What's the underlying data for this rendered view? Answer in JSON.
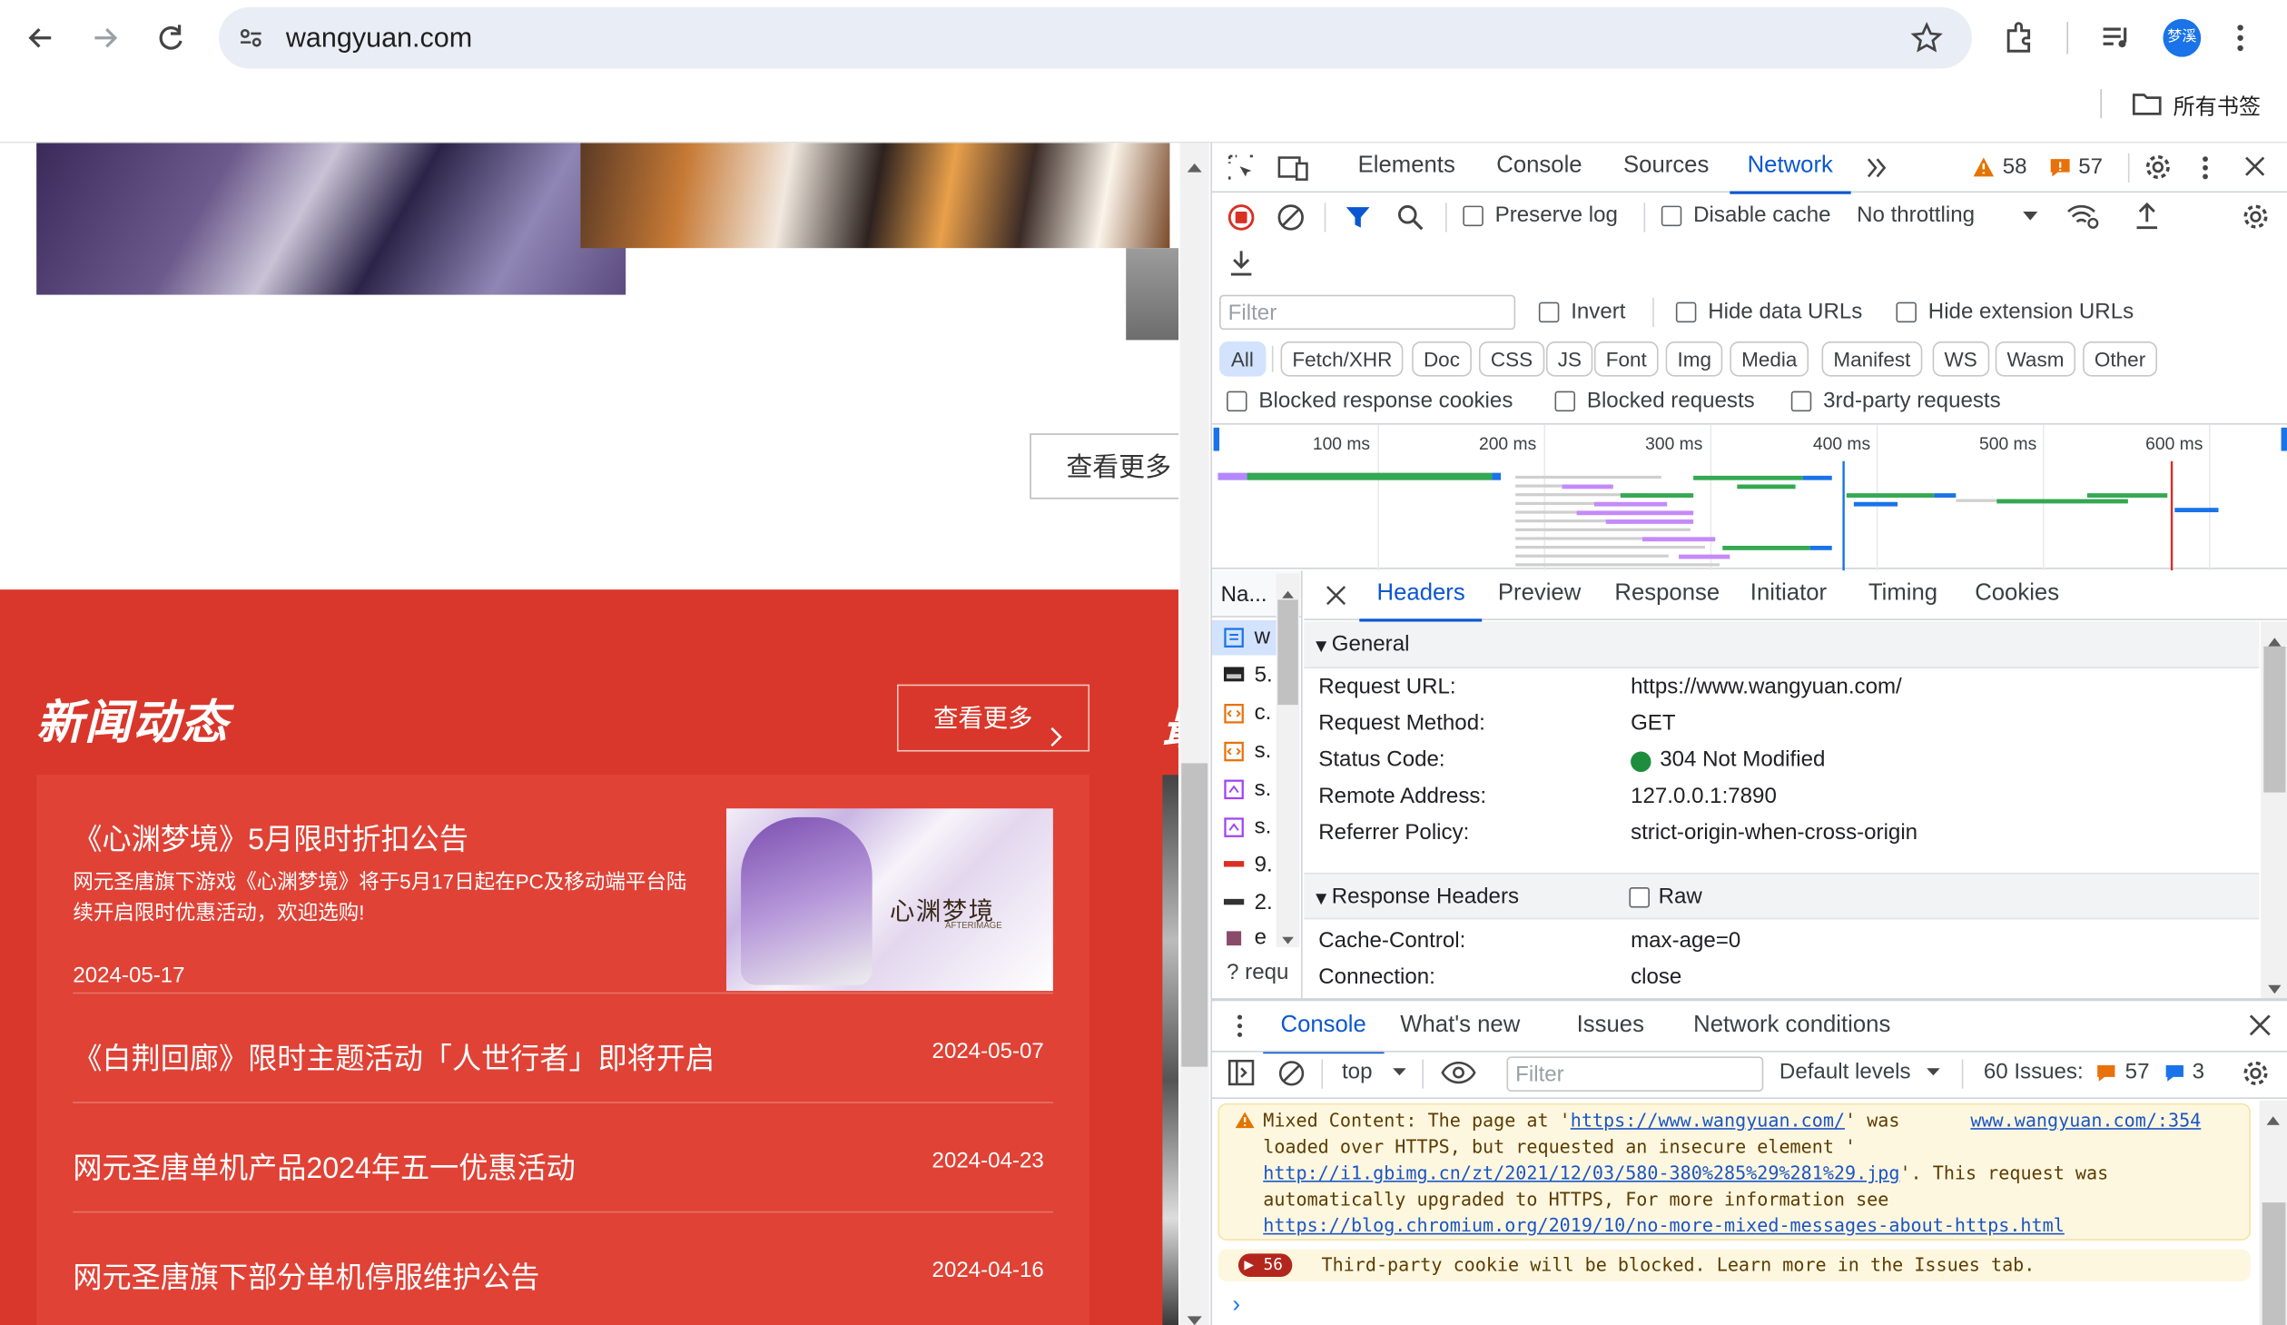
{
  "browser": {
    "url": "wangyuan.com",
    "bookmarks_label": "所有书签",
    "profile_initial": "梦溪"
  },
  "page": {
    "view_more_1": "查看更多",
    "news_heading": "新闻动态",
    "news_more": "查看更多",
    "right_clip": "最",
    "featured": {
      "title": "《心渊梦境》5月限时折扣公告",
      "desc": "网元圣唐旗下游戏《心渊梦境》将于5月17日起在PC及移动端平台陆续开启限时优惠活动，欢迎选购!",
      "date": "2024-05-17",
      "thumb_text": "心渊梦境",
      "thumb_sub": "AFTERIMAGE"
    },
    "news": [
      {
        "title": "《白荆回廊》限时主题活动「人世行者」即将开启",
        "date": "2024-05-07"
      },
      {
        "title": "网元圣唐单机产品2024年五一优惠活动",
        "date": "2024-04-23"
      },
      {
        "title": "网元圣唐旗下部分单机停服维护公告",
        "date": "2024-04-16"
      }
    ]
  },
  "devtools": {
    "tabs": [
      "Elements",
      "Console",
      "Sources",
      "Network"
    ],
    "active_tab": "Network",
    "warnings_count": "58",
    "errors_count": "57",
    "toolbar": {
      "preserve_log": "Preserve log",
      "disable_cache": "Disable cache",
      "throttling": "No throttling"
    },
    "filter_placeholder": "Filter",
    "invert": "Invert",
    "hide_data_urls": "Hide data URLs",
    "hide_extension_urls": "Hide extension URLs",
    "type_filters": [
      "All",
      "Fetch/XHR",
      "Doc",
      "CSS",
      "JS",
      "Font",
      "Img",
      "Media",
      "Manifest",
      "WS",
      "Wasm",
      "Other"
    ],
    "blocked_response_cookies": "Blocked response cookies",
    "blocked_requests": "Blocked requests",
    "third_party_requests": "3rd-party requests",
    "timeline_ticks": [
      "100 ms",
      "200 ms",
      "300 ms",
      "400 ms",
      "500 ms",
      "600 ms"
    ],
    "name_col": "Na...",
    "request_rows": [
      "w",
      "5.",
      "c.",
      "s.",
      "s.",
      "s.",
      "9.",
      "2.",
      "e"
    ],
    "requests_footer": "requ",
    "detail_tabs": [
      "Headers",
      "Preview",
      "Response",
      "Initiator",
      "Timing",
      "Cookies"
    ],
    "general": {
      "section": "General",
      "rows": [
        {
          "k": "Request URL:",
          "v": "https://www.wangyuan.com/"
        },
        {
          "k": "Request Method:",
          "v": "GET"
        },
        {
          "k": "Status Code:",
          "v": "304 Not Modified"
        },
        {
          "k": "Remote Address:",
          "v": "127.0.0.1:7890"
        },
        {
          "k": "Referrer Policy:",
          "v": "strict-origin-when-cross-origin"
        }
      ]
    },
    "response_headers": {
      "section": "Response Headers",
      "raw": "Raw",
      "rows": [
        {
          "k": "Cache-Control:",
          "v": "max-age=0"
        },
        {
          "k": "Connection:",
          "v": "close"
        }
      ]
    },
    "drawer_tabs": [
      "Console",
      "What's new",
      "Issues",
      "Network conditions"
    ],
    "console": {
      "context": "top",
      "filter_placeholder": "Filter",
      "levels": "Default levels",
      "issues_label": "60 Issues:",
      "issues_errors": "57",
      "issues_info": "3",
      "msg1": {
        "p1": "Mixed Content: The page at '",
        "link1": "https://www.wangyuan.com/",
        "p2": "' was",
        "source": "www.wangyuan.com/:354",
        "l2": "loaded over HTTPS, but requested an insecure element '",
        "link2": "http://i1.gbimg.cn/zt/2021/12/03/580-380%285%29%281%29.jpg",
        "p3": "'. This request was",
        "l4": "automatically upgraded to HTTPS, For more information see",
        "link3": "https://blog.chromium.org/2019/10/no-more-mixed-messages-about-https.html"
      },
      "msg2_count": "56",
      "msg2": "Third-party cookie will be blocked. Learn more in the Issues tab."
    }
  },
  "colors": {
    "accent": "#0b57d0",
    "news_red": "#d9372b",
    "card_red": "#e04236"
  }
}
